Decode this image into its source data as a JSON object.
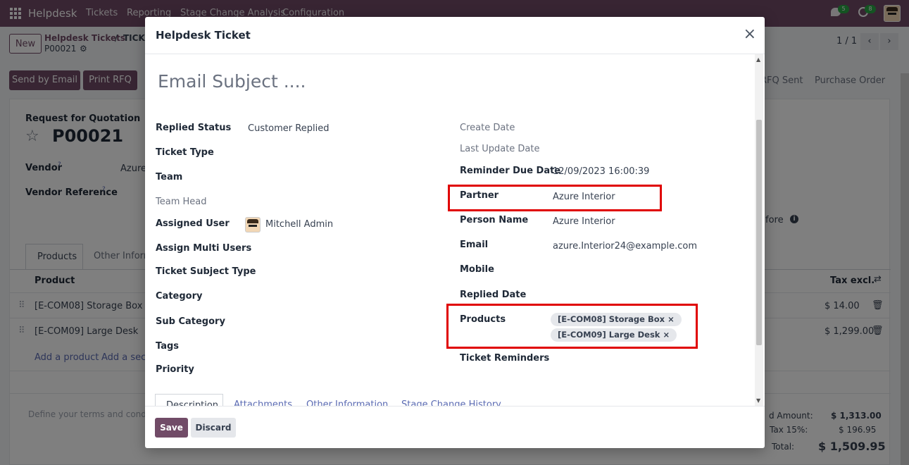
{
  "topbar": {
    "brand": "Helpdesk",
    "menu": [
      "Tickets",
      "Reporting",
      "Stage Change Analysis",
      "Configuration"
    ],
    "chat_badge": "5",
    "activity_badge": "8"
  },
  "control_panel": {
    "new_label": "New",
    "breadcrumb_parent": "Helpdesk Tickets",
    "breadcrumb_sep": "/",
    "breadcrumb_current": "TICKE",
    "record_ref": "P00021",
    "pager": "1 / 1"
  },
  "action_bar": {
    "send_email": "Send by Email",
    "print_rfq": "Print RFQ",
    "stage_rfq_sent": "RFQ Sent",
    "stage_po": "Purchase Order"
  },
  "background_form": {
    "doc_type": "Request for Quotation",
    "doc_number": "P00021",
    "vendor_label": "Vendor",
    "vendor_value": "Azure",
    "vendor_ref_label": "Vendor Reference",
    "tooltip_mark": "?",
    "right_label_fragment": "fore",
    "tabs": [
      "Products",
      "Other Inform"
    ],
    "table_headers": {
      "product": "Product",
      "tax": "Tax excl."
    },
    "rows": [
      {
        "product": "[E-COM08] Storage Box",
        "amount": "$ 14.00"
      },
      {
        "product": "[E-COM09] Large Desk",
        "amount": "$ 1,299.00"
      }
    ],
    "add_product": "Add a product",
    "add_section": "Add a secti",
    "terms_placeholder": "Define your terms and condit",
    "totals": [
      {
        "label": "d Amount:",
        "value": "$ 1,313.00"
      },
      {
        "label": "Tax 15%:",
        "value": "$ 196.95"
      },
      {
        "label": "Total:",
        "value": "$ 1,509.95"
      }
    ]
  },
  "modal": {
    "title": "Helpdesk Ticket",
    "close_glyph": "×",
    "subject_placeholder": "Email Subject ....",
    "left_fields": {
      "replied_status": {
        "label": "Replied Status",
        "value": "Customer Replied"
      },
      "ticket_type": {
        "label": "Ticket Type"
      },
      "team": {
        "label": "Team"
      },
      "team_head": {
        "label": "Team Head"
      },
      "assigned_user": {
        "label": "Assigned User",
        "value": "Mitchell Admin"
      },
      "assign_multi": {
        "label": "Assign Multi Users"
      },
      "subject_type": {
        "label": "Ticket Subject Type"
      },
      "category": {
        "label": "Category"
      },
      "sub_category": {
        "label": "Sub Category"
      },
      "tags": {
        "label": "Tags"
      },
      "priority": {
        "label": "Priority"
      }
    },
    "right_fields": {
      "create_date": {
        "label": "Create Date"
      },
      "last_update": {
        "label": "Last Update Date"
      },
      "reminder_due": {
        "label": "Reminder Due Date",
        "value": "12/09/2023 16:00:39"
      },
      "partner": {
        "label": "Partner",
        "value": "Azure Interior"
      },
      "person_name": {
        "label": "Person Name",
        "value": "Azure Interior"
      },
      "email": {
        "label": "Email",
        "value": "azure.Interior24@example.com"
      },
      "mobile": {
        "label": "Mobile"
      },
      "replied_date": {
        "label": "Replied Date"
      },
      "products": {
        "label": "Products",
        "tags": [
          "[E-COM08] Storage Box",
          "[E-COM09] Large Desk"
        ]
      },
      "ticket_reminders": {
        "label": "Ticket Reminders"
      }
    },
    "tag_remove_glyph": "×",
    "notebook_tabs": [
      "Description",
      "Attachments",
      "Other Information",
      "Stage Change History"
    ],
    "save_label": "Save",
    "discard_label": "Discard"
  },
  "colors": {
    "brand": "#714b67",
    "highlight": "#e00000",
    "badge": "#28a745"
  }
}
